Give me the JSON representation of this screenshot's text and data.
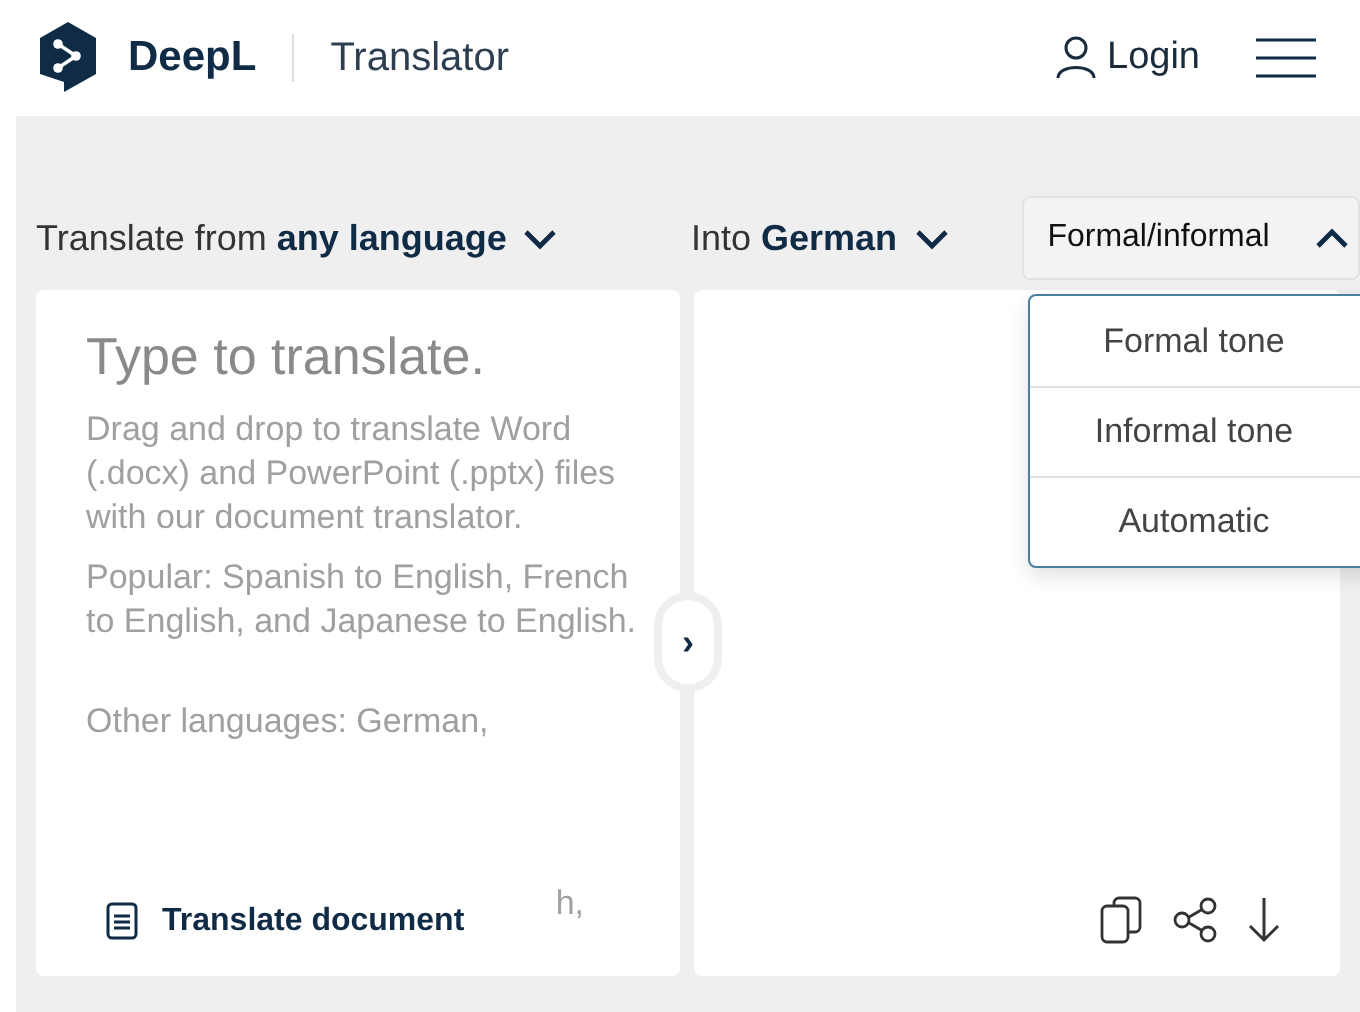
{
  "header": {
    "brand": "DeepL",
    "product": "Translator",
    "login": "Login"
  },
  "language_bar": {
    "source": {
      "prefix": "Translate from",
      "value": "any language"
    },
    "target": {
      "prefix": "Into",
      "value": "German"
    },
    "formality": {
      "label": "Formal/informal",
      "expanded": true,
      "options": [
        "Formal tone",
        "Informal tone",
        "Automatic"
      ]
    }
  },
  "source_panel": {
    "placeholder": "Type to translate.",
    "hints": [
      "Drag and drop to translate Word (.docx) and PowerPoint (.pptx) files with our document translator.",
      "Popular: Spanish to English, French to English, and Japanese to English.",
      "Other languages: German,"
    ],
    "hint_fragment": "h,",
    "document_button": "Translate document"
  },
  "swap_button": "›"
}
